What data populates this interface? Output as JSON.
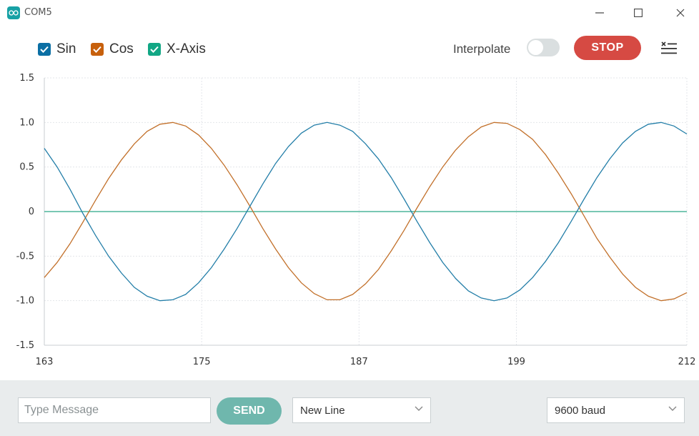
{
  "window": {
    "title": "COM5"
  },
  "legend": [
    {
      "label": "Sin",
      "color": "#0b6fa4"
    },
    {
      "label": "Cos",
      "color": "#c7600c"
    },
    {
      "label": "X-Axis",
      "color": "#12a785"
    }
  ],
  "interpolate": {
    "label": "Interpolate",
    "enabled": false
  },
  "stop_button": {
    "label": "STOP"
  },
  "chart_data": {
    "type": "line",
    "xlim": [
      163,
      212
    ],
    "ylim": [
      -1.5,
      1.5
    ],
    "x_ticks": [
      "163",
      "175",
      "187",
      "199",
      "212"
    ],
    "y_ticks": [
      "1.5",
      "1.0",
      "0.5",
      "0",
      "-0.5",
      "-1.0",
      "-1.5"
    ],
    "grid": true,
    "series": [
      {
        "name": "Sin",
        "color": "#237ea8",
        "values": [
          0.71,
          0.5,
          0.25,
          -0.02,
          -0.27,
          -0.5,
          -0.69,
          -0.85,
          -0.95,
          -1.0,
          -0.99,
          -0.93,
          -0.8,
          -0.63,
          -0.42,
          -0.19,
          0.06,
          0.31,
          0.54,
          0.73,
          0.88,
          0.97,
          1.0,
          0.97,
          0.9,
          0.76,
          0.59,
          0.38,
          0.14,
          -0.11,
          -0.35,
          -0.57,
          -0.75,
          -0.89,
          -0.97,
          -1.0,
          -0.97,
          -0.88,
          -0.74,
          -0.56,
          -0.35,
          -0.11,
          0.14,
          0.38,
          0.59,
          0.77,
          0.9,
          0.98,
          1.0,
          0.96,
          0.87
        ]
      },
      {
        "name": "Cos",
        "color": "#c2702a",
        "values": [
          -0.74,
          -0.57,
          -0.36,
          -0.12,
          0.13,
          0.37,
          0.58,
          0.76,
          0.9,
          0.98,
          1.0,
          0.96,
          0.86,
          0.71,
          0.52,
          0.3,
          0.06,
          -0.19,
          -0.42,
          -0.63,
          -0.8,
          -0.92,
          -0.99,
          -0.99,
          -0.93,
          -0.81,
          -0.65,
          -0.44,
          -0.21,
          0.04,
          0.28,
          0.5,
          0.69,
          0.84,
          0.95,
          1.0,
          0.99,
          0.92,
          0.81,
          0.64,
          0.43,
          0.2,
          -0.05,
          -0.3,
          -0.51,
          -0.7,
          -0.85,
          -0.95,
          -1.0,
          -0.98,
          -0.91
        ]
      },
      {
        "name": "X-Axis",
        "color": "#2aa888",
        "values": [
          0,
          0,
          0,
          0,
          0,
          0,
          0,
          0,
          0,
          0,
          0,
          0,
          0,
          0,
          0,
          0,
          0,
          0,
          0,
          0,
          0,
          0,
          0,
          0,
          0,
          0,
          0,
          0,
          0,
          0,
          0,
          0,
          0,
          0,
          0,
          0,
          0,
          0,
          0,
          0,
          0,
          0,
          0,
          0,
          0,
          0,
          0,
          0,
          0,
          0,
          0
        ]
      }
    ]
  },
  "bottom": {
    "message_placeholder": "Type Message",
    "send_label": "SEND",
    "line_ending": "New Line",
    "baud_rate": "9600 baud"
  }
}
